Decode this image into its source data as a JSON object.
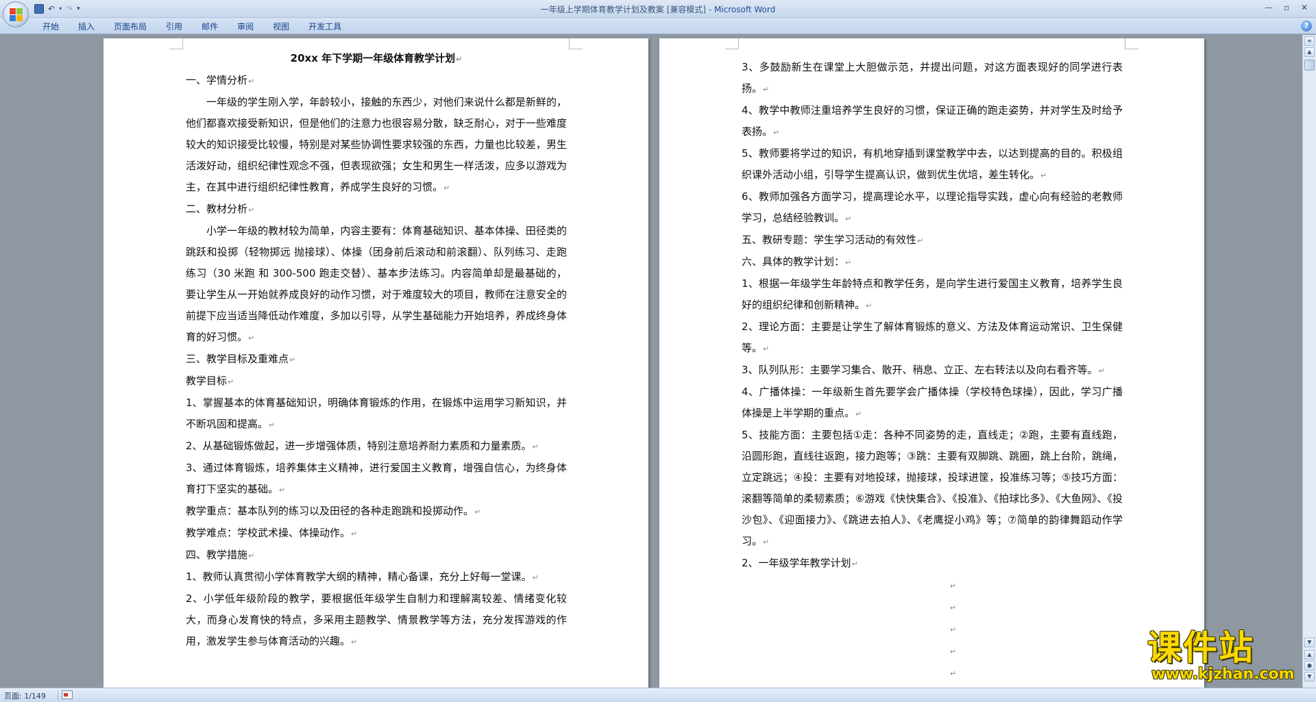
{
  "window": {
    "title_doc": "一年级上学期体育教学计划及教案 [兼容模式]",
    "title_sep": " - ",
    "title_app": "Microsoft Word",
    "qat_dropdown": "▾"
  },
  "ribbon": {
    "tabs": [
      "开始",
      "插入",
      "页面布局",
      "引用",
      "邮件",
      "审阅",
      "视图",
      "开发工具"
    ],
    "help": "?"
  },
  "pages": {
    "left": [
      {
        "cls": "title",
        "text": "20xx 年下学期一年级体育教学计划"
      },
      {
        "cls": "",
        "text": "一、学情分析"
      },
      {
        "cls": "indent",
        "text": "一年级的学生刚入学，年龄较小，接触的东西少，对他们来说什么都是新鲜的，他们都喜欢接受新知识，但是他们的注意力也很容易分散，缺乏耐心，对于一些难度较大的知识接受比较慢，特别是对某些协调性要求较强的东西，力量也比较差，男生活泼好动，组织纪律性观念不强，但表现欲强；女生和男生一样活泼，应多以游戏为主，在其中进行组织纪律性教育，养成学生良好的习惯。"
      },
      {
        "cls": "",
        "text": "二、教材分析"
      },
      {
        "cls": "indent",
        "text": "小学一年级的教材较为简单，内容主要有：体育基础知识、基本体操、田径类的跳跃和投掷（轻物掷远 抛接球）、体操（团身前后滚动和前滚翻）、队列练习、走跑练习（30 米跑 和 300-500 跑走交替）、基本步法练习。内容简单却是最基础的，要让学生从一开始就养成良好的动作习惯，对于难度较大的项目，教师在注意安全的前提下应当适当降低动作难度，多加以引导，从学生基础能力开始培养，养成终身体育的好习惯。"
      },
      {
        "cls": "",
        "text": "三、教学目标及重难点"
      },
      {
        "cls": "",
        "text": "教学目标"
      },
      {
        "cls": "",
        "text": "1、掌握基本的体育基础知识，明确体育锻炼的作用，在锻炼中运用学习新知识，并不断巩固和提高。"
      },
      {
        "cls": "",
        "text": "2、从基础锻炼做起，进一步增强体质，特别注意培养耐力素质和力量素质。"
      },
      {
        "cls": "",
        "text": "3、通过体育锻炼，培养集体主义精神，进行爱国主义教育，增强自信心，为终身体育打下坚实的基础。"
      },
      {
        "cls": "",
        "text": "教学重点：基本队列的练习以及田径的各种走跑跳和投掷动作。"
      },
      {
        "cls": "",
        "text": "教学难点：学校武术操、体操动作。"
      },
      {
        "cls": "",
        "text": "四、教学措施"
      },
      {
        "cls": "",
        "text": "1、教师认真贯彻小学体育教学大纲的精神，精心备课，充分上好每一堂课。"
      },
      {
        "cls": "",
        "text": "2、小学低年级阶段的教学，要根据低年级学生自制力和理解离较差、情绪变化较大，而身心发育快的特点，多采用主题教学、情景教学等方法，充分发挥游戏的作用，激发学生参与体育活动的兴趣。"
      }
    ],
    "right": [
      {
        "cls": "",
        "text": "3、多鼓励新生在课堂上大胆做示范，并提出问题，对这方面表现好的同学进行表扬。"
      },
      {
        "cls": "",
        "text": "4、教学中教师注重培养学生良好的习惯，保证正确的跑走姿势，并对学生及时给予表扬。"
      },
      {
        "cls": "",
        "text": "5、教师要将学过的知识，有机地穿插到课堂教学中去，以达到提高的目的。积极组织课外活动小组，引导学生提高认识，做到优生优培，差生转化。"
      },
      {
        "cls": "",
        "text": "6、教师加强各方面学习，提高理论水平，以理论指导实践，虚心向有经验的老教师学习，总结经验教训。"
      },
      {
        "cls": "",
        "text": "五、教研专题：学生学习活动的有效性"
      },
      {
        "cls": "",
        "text": "六、具体的教学计划："
      },
      {
        "cls": "",
        "text": "1、根据一年级学生年龄特点和教学任务，是向学生进行爱国主义教育，培养学生良好的组织纪律和创新精神。"
      },
      {
        "cls": "",
        "text": "2、理论方面：主要是让学生了解体育锻炼的意义、方法及体育运动常识、卫生保健等。"
      },
      {
        "cls": "",
        "text": "3、队列队形：主要学习集合、散开、稍息、立正、左右转法以及向右看齐等。"
      },
      {
        "cls": "",
        "text": "4、广播体操：一年级新生首先要学会广播体操（学校特色球操），因此，学习广播体操是上半学期的重点。"
      },
      {
        "cls": "",
        "text": "5、技能方面：主要包括①走：各种不同姿势的走，直线走；②跑，主要有直线跑，沿圆形跑，直线往返跑，接力跑等；③跳：主要有双脚跳、跳圈，跳上台阶，跳绳，立定跳远；④投：主要有对地投球，抛接球，投球进筐，投准练习等；⑤技巧方面：滚翻等简单的柔韧素质；⑥游戏《快快集合》、《投准》、《拍球比多》、《大鱼网》、《投沙包》、《迎面接力》、《跳进去拍人》、《老鹰捉小鸡》等；⑦简单的韵律舞蹈动作学习。"
      },
      {
        "cls": "",
        "text": "2、一年级学年教学计划"
      },
      {
        "cls": "markonly",
        "text": ""
      },
      {
        "cls": "markonly",
        "text": ""
      },
      {
        "cls": "markonly",
        "text": ""
      },
      {
        "cls": "markonly",
        "text": ""
      },
      {
        "cls": "markonly",
        "text": ""
      }
    ]
  },
  "status": {
    "page": "页面: 1/149"
  },
  "watermark": {
    "cn": "课件站",
    "url": "www.kjzhan.com"
  },
  "colors": {
    "office_logo": [
      "#e8452c",
      "#8cc63f",
      "#2f7ed8",
      "#f7b500"
    ]
  }
}
